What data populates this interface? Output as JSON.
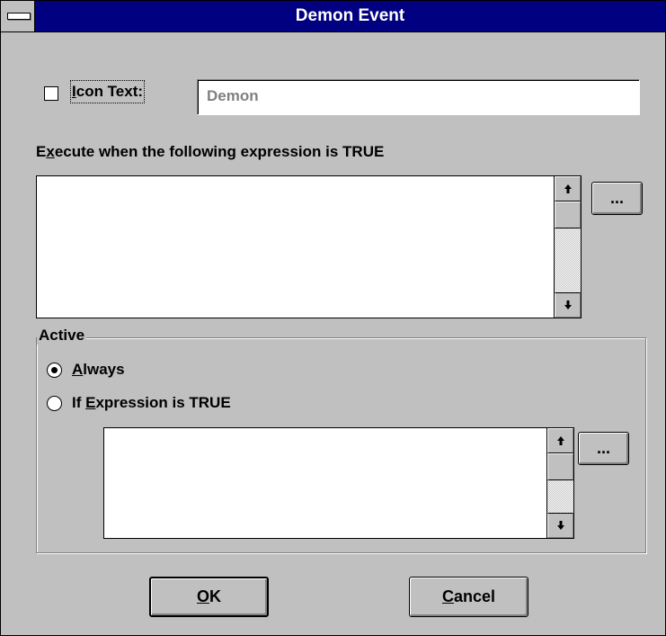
{
  "window": {
    "title": "Demon Event"
  },
  "icon_text": {
    "checkbox_label": "Icon Text:",
    "checked": false,
    "value": "Demon"
  },
  "execute": {
    "label": "Execute when the following expression is TRUE",
    "mnemonic": "x",
    "value": "",
    "browse_label": "..."
  },
  "active": {
    "group_title": "Active",
    "options": [
      {
        "label": "Always",
        "selected": true
      },
      {
        "label": "If Expression is TRUE",
        "selected": false
      }
    ],
    "expression_value": "",
    "browse_label": "..."
  },
  "buttons": {
    "ok": "OK",
    "cancel": "Cancel"
  },
  "icons": [
    "system-menu-icon",
    "scroll-up-arrow-icon",
    "scroll-down-arrow-icon",
    "radio-selected-icon",
    "radio-unselected-icon"
  ]
}
